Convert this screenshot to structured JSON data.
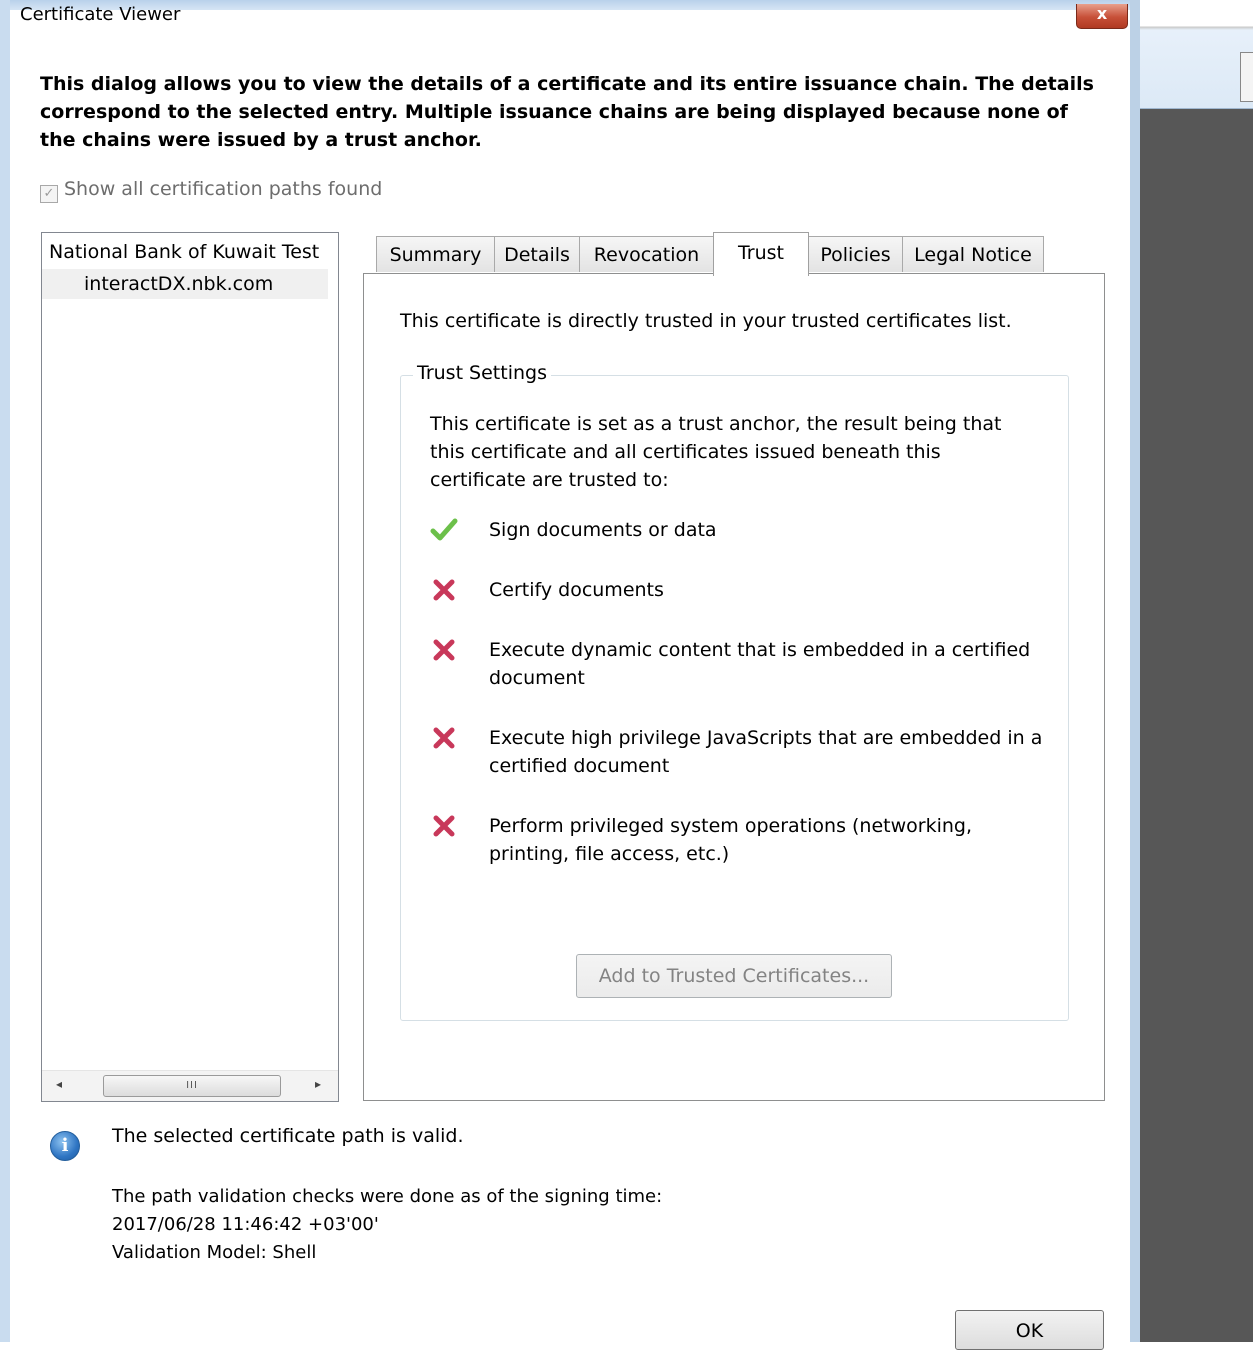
{
  "window": {
    "title": "Certificate Viewer",
    "close_label": "x"
  },
  "intro": "This dialog allows you to view the details of a certificate and its entire issuance chain. The details correspond to the selected entry. Multiple issuance chains are being displayed because none of the chains were issued by a trust anchor.",
  "show_all_paths": {
    "label": "Show all certification paths found",
    "checked": true,
    "enabled": false
  },
  "tree": {
    "items": [
      {
        "label": "National Bank of Kuwait Test"
      },
      {
        "label": "interactDX.nbk.com",
        "selected": true
      }
    ],
    "scroll_left": "◂",
    "scroll_right": "▸",
    "scroll_thumb": "III"
  },
  "tabs": [
    {
      "label": "Summary"
    },
    {
      "label": "Details"
    },
    {
      "label": "Revocation"
    },
    {
      "label": "Trust",
      "active": true
    },
    {
      "label": "Policies"
    },
    {
      "label": "Legal Notice"
    }
  ],
  "trust": {
    "heading": "This certificate is directly trusted in your trusted certificates list.",
    "group_title": "Trust Settings",
    "description": "This certificate is set as a trust anchor, the result being that this certificate and all certificates issued beneath this certificate are trusted to:",
    "permissions": [
      {
        "text": "Sign documents or data",
        "allowed": true,
        "icon": "check-icon"
      },
      {
        "text": "Certify documents",
        "allowed": false,
        "icon": "cross-icon"
      },
      {
        "text": "Execute dynamic content that is embedded in a certified document",
        "allowed": false,
        "icon": "cross-icon"
      },
      {
        "text": "Execute high privilege JavaScripts that are embedded in a certified document",
        "allowed": false,
        "icon": "cross-icon"
      },
      {
        "text": "Perform privileged system operations (networking, printing, file access, etc.)",
        "allowed": false,
        "icon": "cross-icon"
      }
    ],
    "add_button": "Add to Trusted Certificates..."
  },
  "status": {
    "icon": "info-icon",
    "message": "The selected certificate path is valid.",
    "details": [
      "The path validation checks were done as of the signing time:",
      "2017/06/28 11:46:42 +03'00'",
      "Validation Model: Shell"
    ]
  },
  "ok_button": "OK",
  "colors": {
    "check": "#6cc04a",
    "cross": "#c8385a",
    "info": "#2f75c3"
  }
}
